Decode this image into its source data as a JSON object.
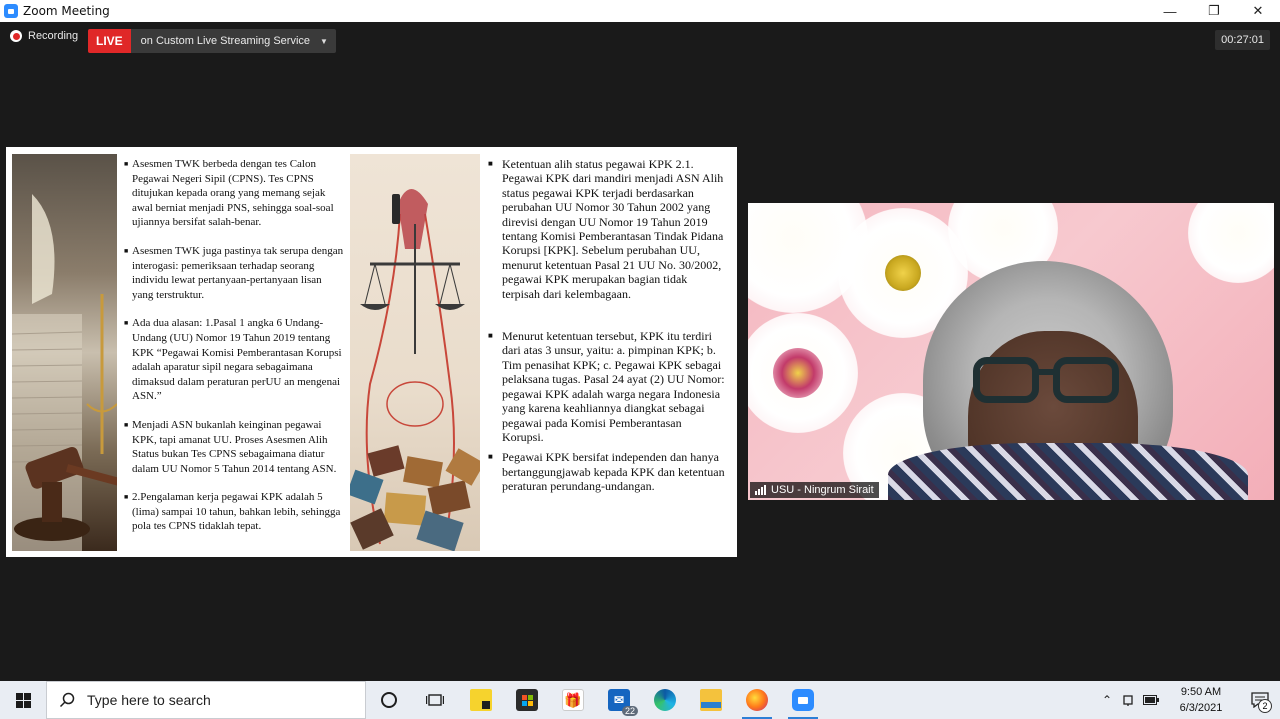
{
  "window": {
    "title": "Zoom Meeting",
    "minimize": "—",
    "restore": "❐",
    "close": "✕"
  },
  "meeting": {
    "recording_label": "Recording",
    "live_label": "LIVE",
    "live_service": "on Custom Live Streaming Service",
    "timer": "00:27:01"
  },
  "slide": {
    "left_bullets": [
      "Asesmen TWK berbeda dengan tes Calon Pegawai Negeri Sipil (CPNS). Tes CPNS ditujukan kepada orang yang memang sejak awal berniat menjadi PNS, sehingga soal-soal ujiannya bersifat salah-benar.",
      "Asesmen TWK juga pastinya tak serupa dengan interogasi: pemeriksaan terhadap seorang individu lewat pertanyaan-pertanyaan lisan yang terstruktur.",
      "Ada dua alasan: 1.Pasal 1 angka 6 Undang-Undang (UU) Nomor 19 Tahun 2019 tentang KPK “Pegawai Komisi Pemberantasan Korupsi adalah aparatur sipil negara sebagaimana dimaksud dalam peraturan perUU an mengenai ASN.”",
      "Menjadi ASN bukanlah keinginan pegawai KPK, tapi amanat UU. Proses Asesmen Alih Status bukan Tes CPNS sebagaimana diatur dalam UU Nomor 5 Tahun 2014 tentang ASN.",
      "2.Pengalaman kerja pegawai KPK adalah 5 (lima) sampai 10 tahun, bahkan lebih, sehingga pola tes CPNS tidaklah tepat."
    ],
    "right_bullets": [
      "Ketentuan alih status pegawai KPK 2.1. Pegawai KPK dari mandiri menjadi ASN Alih status pegawai KPK terjadi berdasarkan perubahan UU Nomor 30 Tahun 2002 yang direvisi dengan UU Nomor 19 Tahun 2019 tentang Komisi Pemberantasan Tindak Pidana Korupsi [KPK]. Sebelum perubahan UU, menurut ketentuan Pasal 21 UU No. 30/2002, pegawai KPK merupakan bagian tidak terpisah dari kelembagaan.",
      "Menurut ketentuan tersebut, KPK itu terdiri dari atas 3 unsur, yaitu: a. pimpinan KPK; b. Tim penasihat KPK; c. Pegawai KPK sebagai pelaksana tugas. Pasal 24 ayat (2) UU Nomor: pegawai KPK adalah warga negara Indonesia yang karena keahliannya diangkat sebagai pegawai pada Komisi Pemberantasan Korupsi.",
      "Pegawai KPK bersifat independen dan hanya bertanggungjawab kepada KPK dan ketentuan peraturan perundang-undangan."
    ]
  },
  "video": {
    "participant_name": "USU - Ningrum Sirait"
  },
  "taskbar": {
    "search_placeholder": "Type here to search",
    "mail_badge": "22",
    "time": "9:50 AM",
    "date": "6/3/2021",
    "notification_count": "2"
  },
  "colors": {
    "live_red": "#e02828",
    "zoom_blue": "#2d8cff",
    "meeting_bg": "#1a1a1a"
  }
}
